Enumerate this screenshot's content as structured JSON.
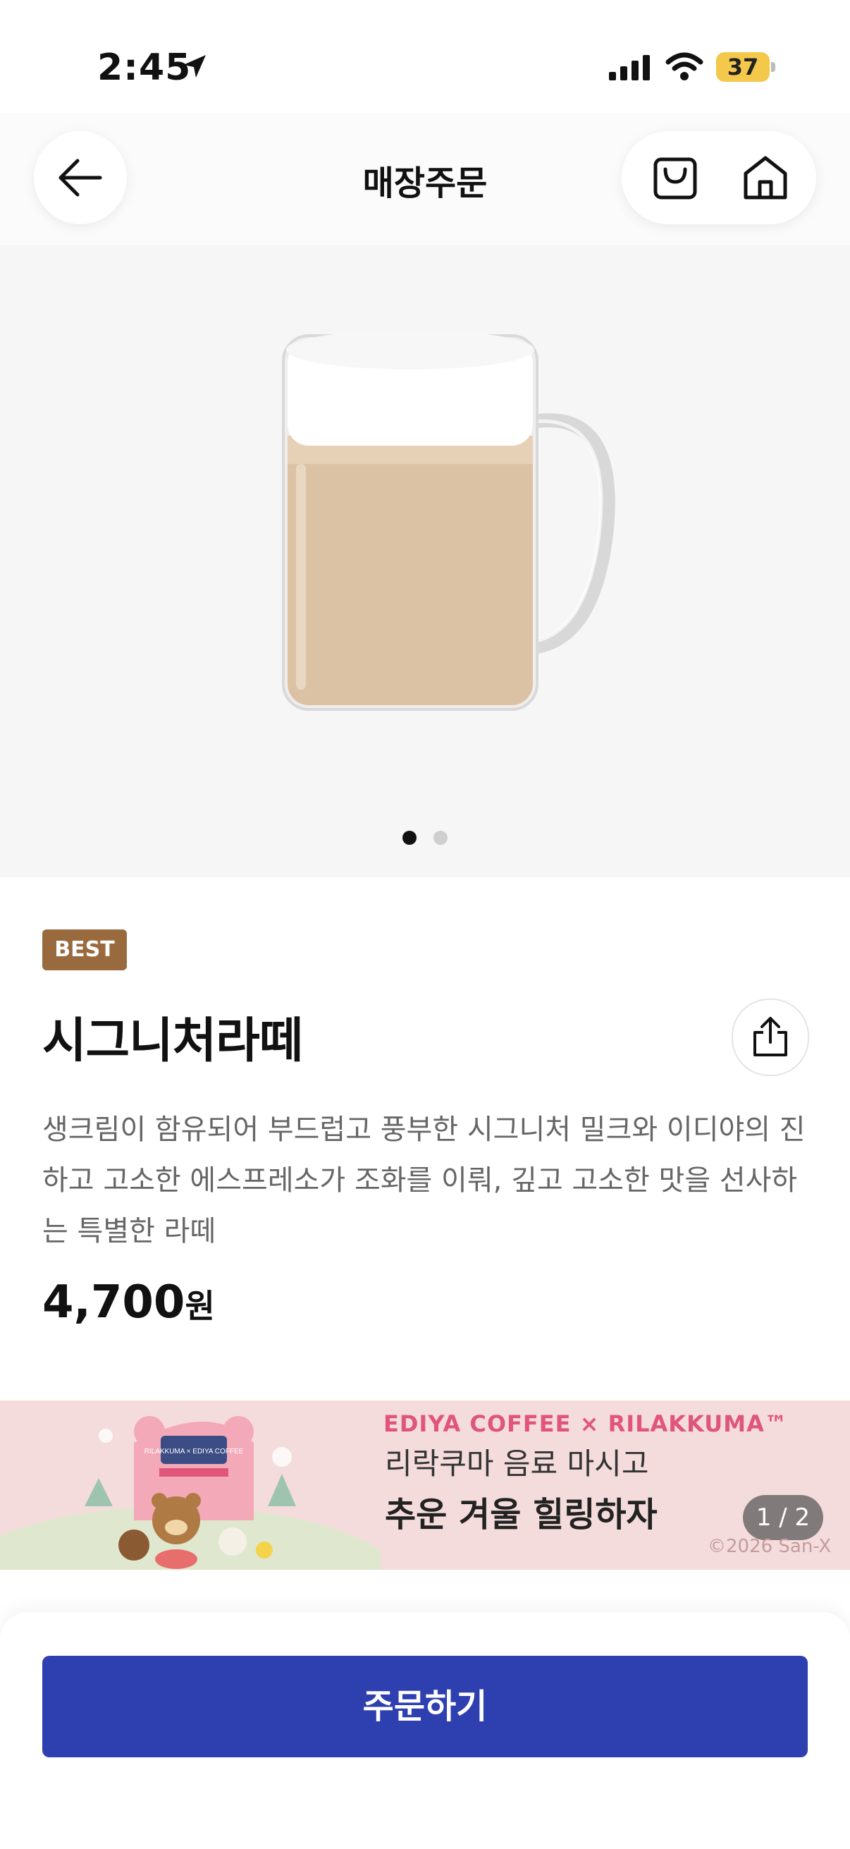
{
  "status_bar": {
    "time": "2:45",
    "battery": "37"
  },
  "header": {
    "title": "매장주문"
  },
  "product": {
    "badge": "BEST",
    "name": "시그니처라떼",
    "description": "생크림이 함유되어 부드럽고 풍부한 시그니처 밀크와 이디야의 진하고 고소한 에스프레소가 조화를 이뤄, 깊고 고소한 맛을 선사하는 특별한 라떼",
    "price_number": "4,700",
    "price_unit": "원"
  },
  "gallery": {
    "current": 1,
    "total": 2
  },
  "banner": {
    "brand": "EDIYA COFFEE × RILAKKUMA™",
    "line1": "리락쿠마 음료 마시고",
    "line2": "추운 겨울 힐링하자",
    "page_indicator": "1 / 2",
    "copyright": "©2026 San-X",
    "art_sign": "RILAKKUMA × EDIYA COFFEE"
  },
  "actions": {
    "order_label": "주문하기"
  },
  "colors": {
    "accent": "#2e3fb0",
    "badge": "#9a6a3f",
    "banner_bg": "#f5dcdc"
  },
  "icons": [
    "location-arrow-icon",
    "signal-icon",
    "wifi-icon",
    "back-arrow-icon",
    "cart-icon",
    "home-icon",
    "share-icon"
  ]
}
